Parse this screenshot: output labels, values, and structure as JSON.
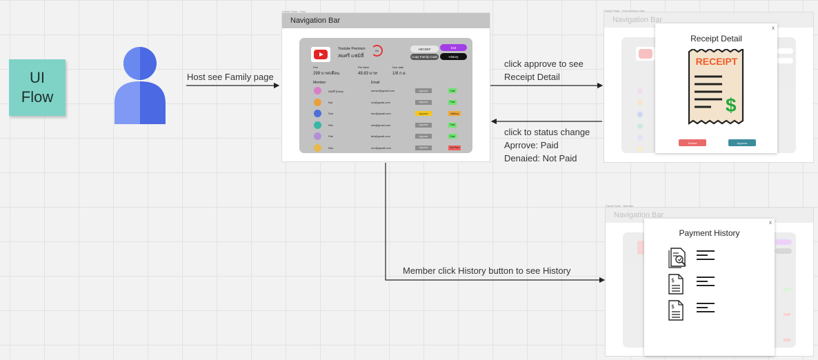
{
  "sticky_note": "UI\nFlow",
  "flow": {
    "host_label": "Host see Family page",
    "approve_label": "click approve to see\nReceipt Detail",
    "status_label": "click to status change\nAprrove: Paid\nDenaied: Not Paid",
    "history_label": "Member click History button to see History"
  },
  "family_frame": {
    "caption": "Family Page - Host",
    "nav_title": "Navigation Bar",
    "plan_label": "Youtube Premium",
    "plan_name": "สมศรี แฟมิลี่",
    "ring_text": "6/6",
    "code": "ABCDEF",
    "copy_label": "Copy Family Code",
    "exit_label": "Exit",
    "history_label": "History",
    "stat1_label": "Fee",
    "stat1_value": "299 บาท/เดือน",
    "stat2_label": "Per Mem",
    "stat2_value": "49.83 บาท",
    "stat3_label": "Due date",
    "stat3_value": "1/8 ก.ย",
    "member_header": "Member",
    "email_header": "Email",
    "approve_label": "Approve",
    "members": [
      {
        "name": "สมศรี (Host)",
        "email": "somsri@gmail.com",
        "status": "Paid",
        "status_color": "#6ee36e",
        "approve_color": "#8c8c8c",
        "avatar": "#d97fc7"
      },
      {
        "name": "Nut",
        "email": "nut@gmail.com",
        "status": "Paid",
        "status_color": "#6ee36e",
        "approve_color": "#8c8c8c",
        "avatar": "#e8a13c"
      },
      {
        "name": "Sun",
        "email": "sun@gmail.com",
        "status": "Waiting",
        "status_color": "#f0a73a",
        "approve_color": "#f4c51a",
        "avatar": "#4e6fd8"
      },
      {
        "name": "Win",
        "email": "win@gmail.com",
        "status": "Paid",
        "status_color": "#6ee36e",
        "approve_color": "#8c8c8c",
        "avatar": "#39b6a5"
      },
      {
        "name": "Fah",
        "email": "fah@gmail.com",
        "status": "Paid",
        "status_color": "#6ee36e",
        "approve_color": "#8c8c8c",
        "avatar": "#b58fd6"
      },
      {
        "name": "Non",
        "email": "non@gmail.com",
        "status": "Not Paid",
        "status_color": "#ef5d5d",
        "approve_color": "#8c8c8c",
        "avatar": "#e8b84a"
      }
    ]
  },
  "receipt_frame": {
    "caption": "Family Page - Host approve view",
    "nav_title": "Navigation Bar",
    "modal_title": "Receipt Detail",
    "receipt_word": "RECEIPT",
    "close": "x",
    "denied_label": "Denied",
    "approve_label": "Approve",
    "colors": {
      "denied": "#ea6a6a",
      "approve": "#3c8c9c",
      "receipt_paper": "#f3e3cc",
      "receipt_red": "#ef5a26",
      "dollar_green": "#23a83c"
    }
  },
  "history_frame": {
    "caption": "Family Page - Member",
    "nav_title": "Navigation Bar",
    "modal_title": "Payment History",
    "close": "x"
  }
}
